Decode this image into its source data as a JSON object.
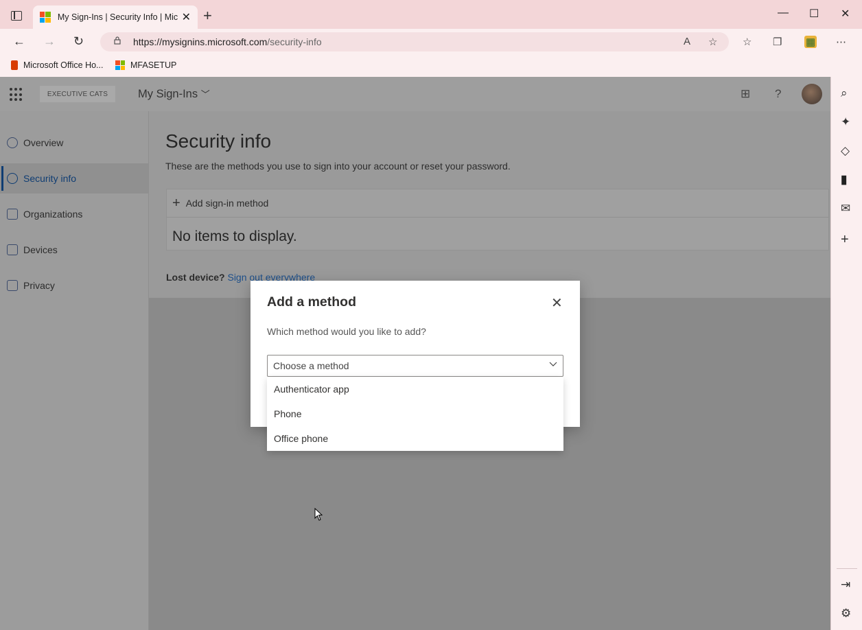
{
  "browser": {
    "tab_title": "My Sign-Ins | Security Info | Microsoft",
    "url_host": "https://mysignins.microsoft.com",
    "url_path": "/security-info",
    "favorites": [
      {
        "label": "Microsoft Office Ho..."
      },
      {
        "label": "MFASETUP"
      }
    ]
  },
  "app": {
    "tenant": "EXECUTIVE CATS",
    "title": "My Sign-Ins"
  },
  "sidebar": {
    "items": [
      {
        "label": "Overview"
      },
      {
        "label": "Security info"
      },
      {
        "label": "Organizations"
      },
      {
        "label": "Devices"
      },
      {
        "label": "Privacy"
      }
    ],
    "active": "Security info"
  },
  "main": {
    "title": "Security info",
    "description": "These are the methods you use to sign into your account or reset your password.",
    "add_label": "Add sign-in method",
    "empty_text": "No items to display.",
    "lost_label": "Lost device?",
    "lost_link": "Sign out everywhere"
  },
  "dialog": {
    "title": "Add a method",
    "question": "Which method would you like to add?",
    "select_placeholder": "Choose a method",
    "options": [
      "Authenticator app",
      "Phone",
      "Office phone"
    ]
  },
  "colors": {
    "accent": "#0f3d73",
    "link": "#1d4f8a"
  }
}
